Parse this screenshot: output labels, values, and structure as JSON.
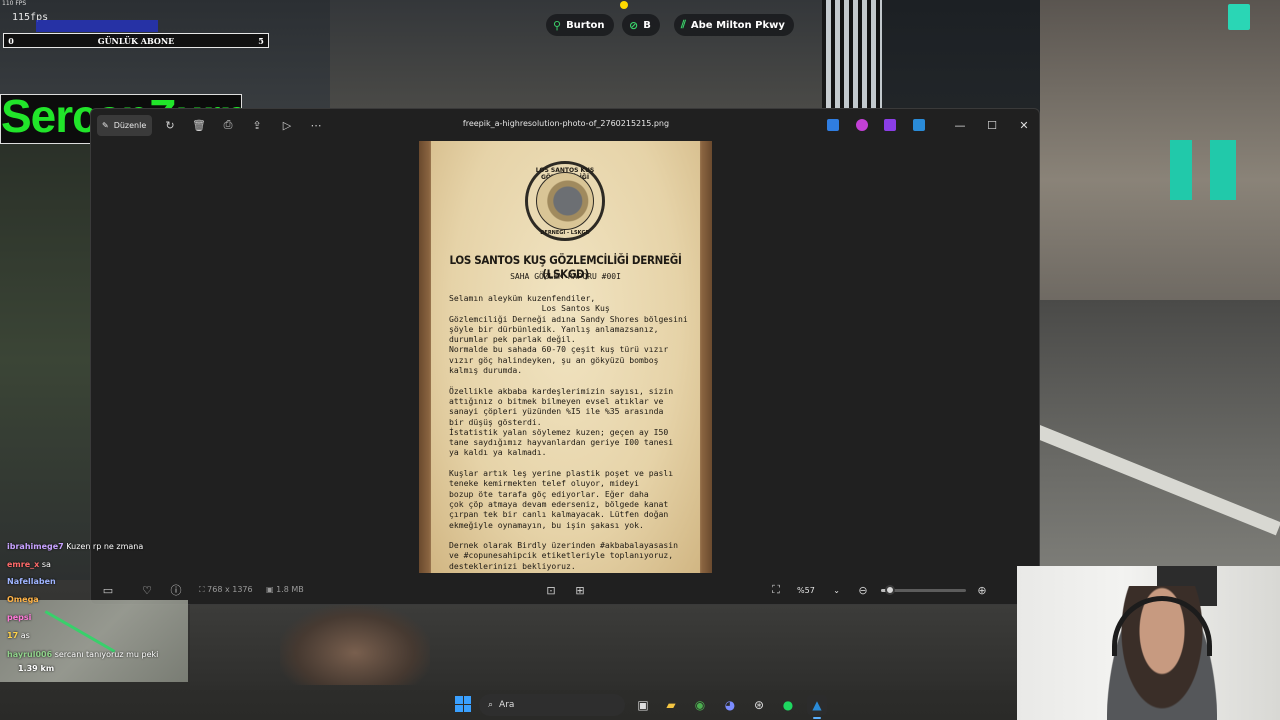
{
  "hud": {
    "fps_small": "110 FPS",
    "fps": "115fps",
    "sub_goal": {
      "left": "0",
      "label": "GÜNLÜK ABONE",
      "right": "5"
    },
    "streamer_name": "SercanZurna",
    "location_chips": [
      {
        "icon": "street-icon",
        "label": "Burton"
      },
      {
        "icon": "compass-icon",
        "label": "B"
      },
      {
        "icon": "road-icon",
        "label": "Abe Milton Pkwy"
      }
    ]
  },
  "photos_window": {
    "edit_label": "Düzenle",
    "filename": "freepik_a-highresolution-photo-of_2760215215.png",
    "dimensions": "768 x 1376",
    "file_size": "1.8 MB",
    "zoom": "%57",
    "zoom_level": 0.1
  },
  "document": {
    "seal_top": "LOS SANTOS KUŞ GÖZLEMCİLİĞİ",
    "seal_bottom": "DERNEĞİ - LSKGD",
    "title": "LOS SANTOS KUŞ GÖZLEMCİLİĞİ DERNEĞİ (LSKGD)",
    "subtitle": "SAHA GÖZLEM RAPORU #00I",
    "body": "Selamın aleyküm kuzenfendiler,\n                   Los Santos Kuş\nGözlemciliği Derneği adına Sandy Shores bölgesini\nşöyle bir dürbünledik. Yanlış anlamazsanız,\ndurumlar pek parlak değil.\nNormalde bu sahada 60-70 çeşit kuş türü vızır\nvızır göç halindeyken, şu an gökyüzü bomboş\nkalmış durumda.\n\nÖzellikle akbaba kardeşlerimizin sayısı, sizin\nattığınız o bitmek bilmeyen evsel atıklar ve\nsanayi çöpleri yüzünden %I5 ile %35 arasında\nbir düşüş gösterdi.\nİstatistik yalan söylemez kuzen; geçen ay I50\ntane saydığımız hayvanlardan geriye I00 tanesi\nya kaldı ya kalmadı.\n\nKuşlar artık leş yerine plastik poşet ve paslı\nteneke kemirmekten telef oluyor, mideyi\nbozup öte tarafa göç ediyorlar. Eğer daha\nçok çöp atmaya devam ederseniz, bölgede kanat\nçırpan tek bir canlı kalmayacak. Lütfen doğan\nekmeğiyle oynamayın, bu işin şakası yok.\n\nDernek olarak Birdly üzerinden #akbabalayasasin\nve #copunesahipcik etiketleriyle toplanıyoruz,\ndesteklerinizi bekliyoruz."
  },
  "chat": [
    {
      "user": "ibrahimege7",
      "message": "Kuzen rp ne zmana",
      "user_color": "#c7a2ff"
    },
    {
      "user": "emre_x",
      "message": "sa",
      "user_color": "#ff6a6a"
    },
    {
      "user": "Nafellaben",
      "message": "",
      "user_color": "#9fb4ff"
    },
    {
      "user": "Omega",
      "message": "",
      "user_color": "#ffb347"
    },
    {
      "user": "pepsi",
      "message": "",
      "user_color": "#ff7ad9"
    },
    {
      "user": "17",
      "message": "as",
      "user_color": "#ffd24a"
    },
    {
      "user": "hayrul006",
      "message": "sercanı tanıyoruz mu peki",
      "user_color": "#8fd18a"
    }
  ],
  "minimap": {
    "distance": "1.39 km"
  },
  "taskbar": {
    "search_placeholder": "Ara"
  },
  "colors": {
    "accent": "#21e52a",
    "window_bg": "#202020",
    "taskbar_accent": "#5ab0ff"
  }
}
